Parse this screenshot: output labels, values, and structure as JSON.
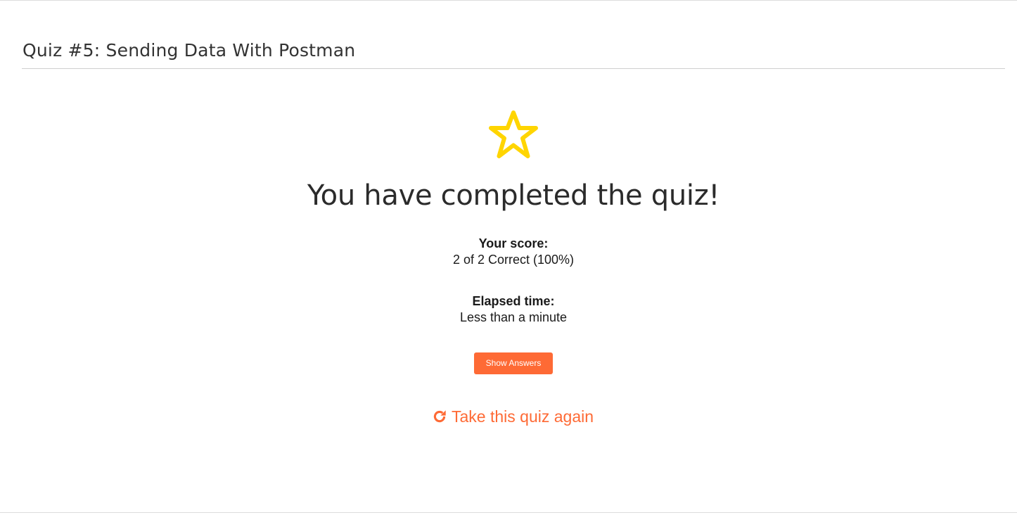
{
  "quiz": {
    "title": "Quiz #5: Sending Data With Postman"
  },
  "results": {
    "star_icon": "star-outline-icon",
    "headline": "You have completed the quiz!",
    "score_label": "Your score:",
    "score_value": "2 of 2 Correct (100%)",
    "time_label": "Elapsed time:",
    "time_value": "Less than a minute",
    "show_answers_label": "Show Answers",
    "retake_icon": "redo-icon",
    "retake_label": "Take this quiz again"
  },
  "colors": {
    "accent": "#fe6a35",
    "star": "#ffd500",
    "text": "#1f1f1f",
    "rule": "#cfcfcf"
  }
}
